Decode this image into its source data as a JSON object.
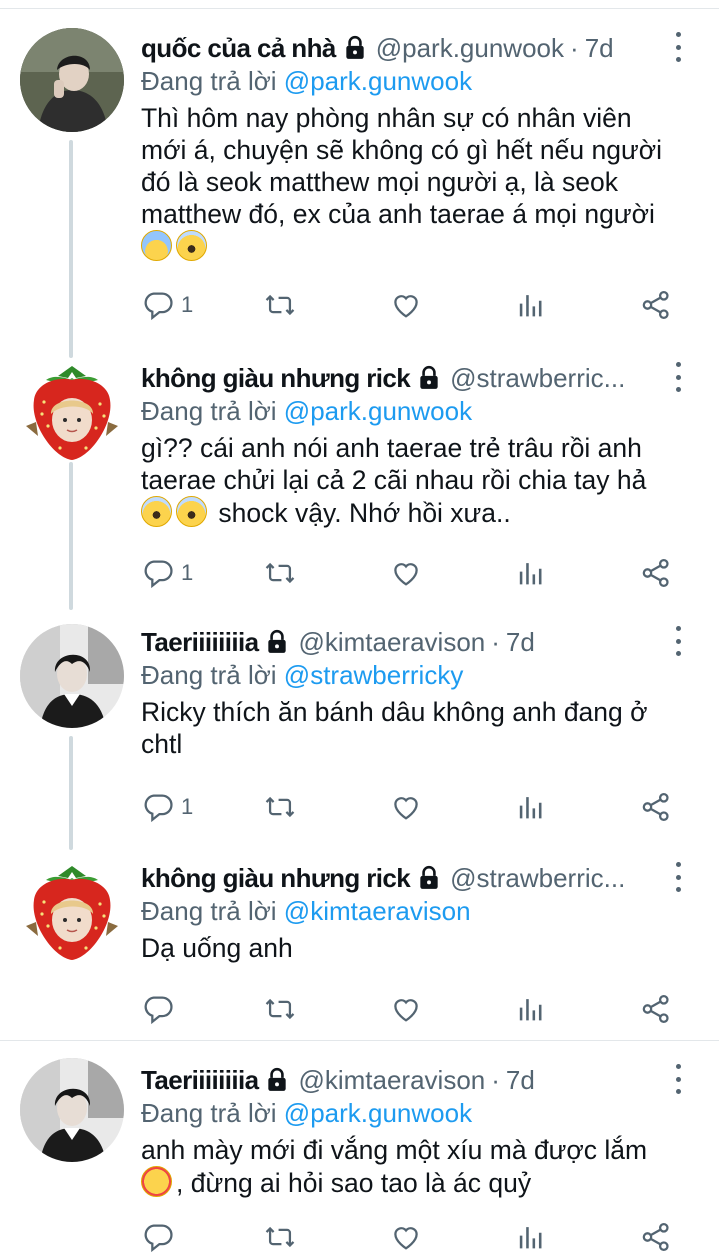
{
  "tweets": [
    {
      "name": "quốc của cả nhà",
      "handle": "@park.gunwook",
      "time": "7d",
      "reply_prefix": "Đang trả lời",
      "reply_to": "@park.gunwook",
      "lines": [
        "Thì hôm nay phòng nhân sự có nhân viên",
        "mới á, chuyện sẽ không có gì hết nếu người",
        "đó là seok matthew mọi người ạ, là seok",
        "matthew đó, ex của anh taerae á mọi người"
      ],
      "emojis": [
        "fearful-face",
        "screaming-face"
      ],
      "reply_count": "1",
      "avatar": "photo-boy-hand-on-face"
    },
    {
      "name": "không giàu nhưng rick",
      "handle": "@strawberric...",
      "time": "",
      "reply_prefix": "Đang trả lời",
      "reply_to": "@park.gunwook",
      "lines": [
        "gì?? cái anh nói anh taerae trẻ trâu rồi anh",
        "taerae chửi lại cả 2 cãi nhau rồi chia tay hả",
        "shock vậy. Nhớ hồi xưa.."
      ],
      "emojis": [
        "screaming-face",
        "screaming-face"
      ],
      "reply_count": "1",
      "avatar": "strawberry-character"
    },
    {
      "name": "Taeriiiiiiiia",
      "handle": "@kimtaeravison",
      "time": "7d",
      "reply_prefix": "Đang trả lời",
      "reply_to": "@strawberricky",
      "lines": [
        "Ricky thích ăn bánh dâu không anh đang ở",
        "chtl"
      ],
      "emojis": [],
      "reply_count": "1",
      "avatar": "photo-boy-bw"
    },
    {
      "name": "không giàu nhưng rick",
      "handle": "@strawberric...",
      "time": "",
      "reply_prefix": "Đang trả lời",
      "reply_to": "@kimtaeravison",
      "lines": [
        "Dạ uống anh"
      ],
      "emojis": [],
      "reply_count": "",
      "avatar": "strawberry-character"
    },
    {
      "name": "Taeriiiiiiiia",
      "handle": "@kimtaeravison",
      "time": "7d",
      "reply_prefix": "Đang trả lời",
      "reply_to": "@park.gunwook",
      "lines": [
        "anh mày mới đi vắng một xíu mà được lắm",
        ", đừng ai hỏi sao tao là ác quỷ"
      ],
      "emojis": [
        "smiling-face-with-hearts"
      ],
      "reply_count": "",
      "avatar": "photo-boy-bw"
    }
  ],
  "colors": {
    "text": "#0f1419",
    "secondary": "#536471",
    "mention": "#1d9bf0",
    "thread_line": "#cfd9de",
    "divider": "#e3e7ea"
  },
  "icons": [
    "lock-icon",
    "more-icon",
    "reply-icon",
    "retweet-icon",
    "like-icon",
    "views-icon",
    "share-icon"
  ]
}
